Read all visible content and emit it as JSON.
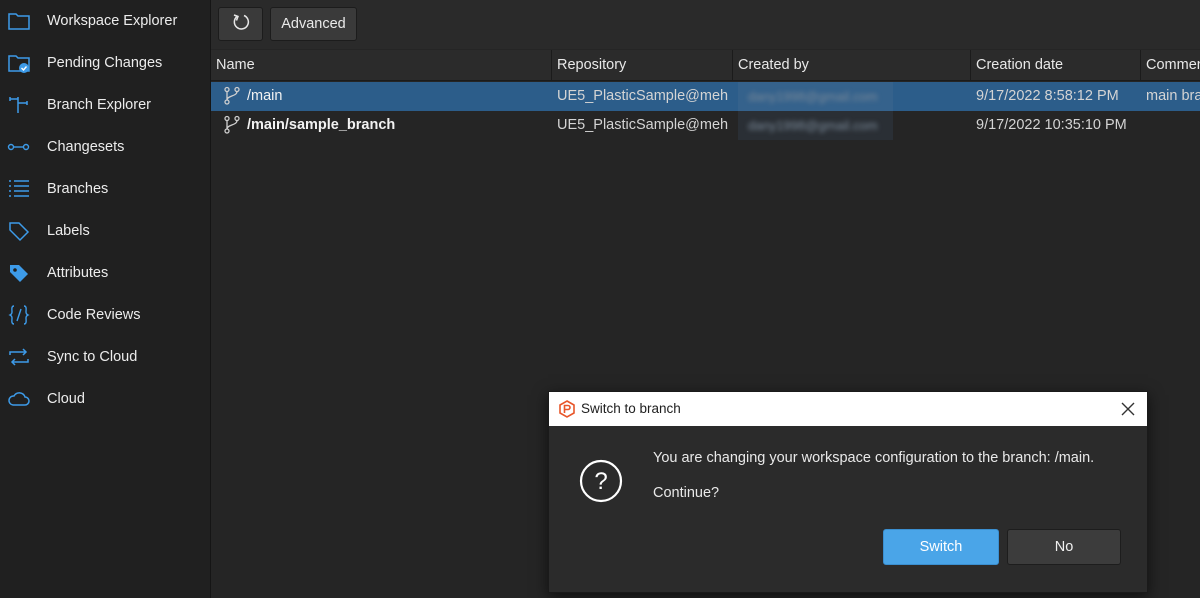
{
  "sidebar": {
    "items": [
      {
        "label": "Workspace Explorer",
        "icon": "folder-icon"
      },
      {
        "label": "Pending Changes",
        "icon": "folder-check-icon"
      },
      {
        "label": "Branch Explorer",
        "icon": "branch-explorer-icon"
      },
      {
        "label": "Changesets",
        "icon": "changesets-icon"
      },
      {
        "label": "Branches",
        "icon": "list-icon"
      },
      {
        "label": "Labels",
        "icon": "tag-icon"
      },
      {
        "label": "Attributes",
        "icon": "attribute-tag-icon"
      },
      {
        "label": "Code Reviews",
        "icon": "code-braces-icon"
      },
      {
        "label": "Sync to Cloud",
        "icon": "sync-icon"
      },
      {
        "label": "Cloud",
        "icon": "cloud-icon"
      }
    ]
  },
  "toolbar": {
    "refresh_icon": "refresh-icon",
    "advanced_label": "Advanced"
  },
  "table": {
    "columns": [
      "Name",
      "Repository",
      "Created by",
      "Creation date",
      "Comment"
    ],
    "rows": [
      {
        "name": "/main",
        "repository": "UE5_PlasticSample@meh",
        "created_by": "dany1998@gmail.com",
        "creation_date": "9/17/2022 8:58:12 PM",
        "comment": "main branch",
        "selected": true
      },
      {
        "name": "/main/sample_branch",
        "repository": "UE5_PlasticSample@meh",
        "created_by": "dany1998@gmail.com",
        "creation_date": "9/17/2022 10:35:10 PM",
        "comment": "",
        "selected": false
      }
    ]
  },
  "dialog": {
    "title": "Switch to branch",
    "message": "You are changing your workspace configuration to the branch: /main.",
    "question": "Continue?",
    "switch_label": "Switch",
    "no_label": "No"
  },
  "colors": {
    "accent": "#4aa5e8",
    "selected_row": "#2c5d8a",
    "icon_blue": "#3d9be9",
    "logo_orange": "#e8562a"
  }
}
